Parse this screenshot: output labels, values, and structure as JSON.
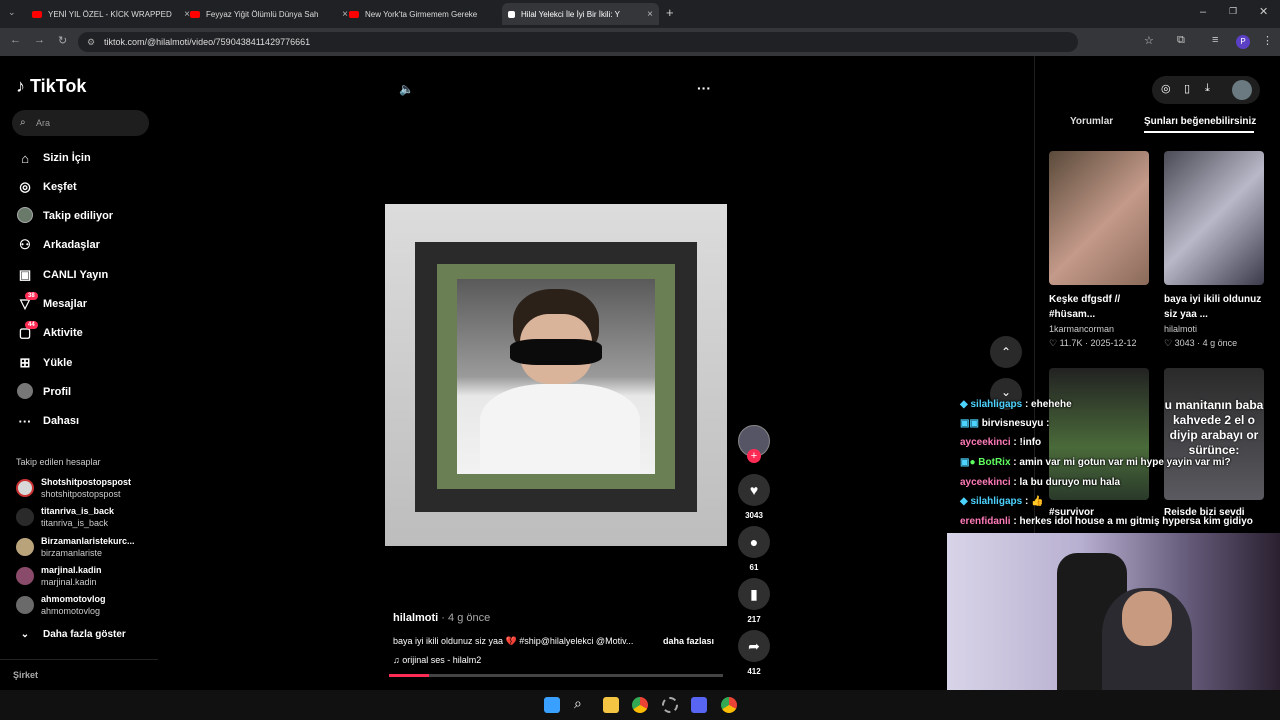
{
  "browser": {
    "tabs": [
      {
        "title": "YENİ YIL ÖZEL - KİCK WRAPPED"
      },
      {
        "title": "Feyyaz Yiğit Ölümlü Dünya Sah"
      },
      {
        "title": "New York'ta Girmemem Gereke"
      },
      {
        "title": "Hilal Yelekci İle İyi Bir İkili: Y"
      }
    ],
    "url": "tiktok.com/@hilalmoti/video/7590438411429776661"
  },
  "tiktok": {
    "logo": "TikTok",
    "search_placeholder": "Ara",
    "nav": [
      {
        "label": "Sizin İçin",
        "icon": "home-icon"
      },
      {
        "label": "Keşfet",
        "icon": "compass-icon"
      },
      {
        "label": "Takip ediliyor",
        "icon": "following-icon"
      },
      {
        "label": "Arkadaşlar",
        "icon": "friends-icon"
      },
      {
        "label": "CANLI Yayın",
        "icon": "live-icon"
      },
      {
        "label": "Mesajlar",
        "icon": "messages-icon",
        "badge": "38"
      },
      {
        "label": "Aktivite",
        "icon": "activity-icon",
        "badge": "44"
      },
      {
        "label": "Yükle",
        "icon": "upload-icon"
      },
      {
        "label": "Profil",
        "icon": "profile-icon"
      },
      {
        "label": "Dahası",
        "icon": "more-icon"
      }
    ],
    "following_heading": "Takip edilen hesaplar",
    "following": [
      {
        "name": "Shotshitpostopspost",
        "handle": "shotshitpostopspost"
      },
      {
        "name": "titanriva_is_back",
        "handle": "titanriva_is_back"
      },
      {
        "name": "Birzamanlaristekurc...",
        "handle": "birzamanlariste"
      },
      {
        "name": "marjinal.kadin",
        "handle": "marjinal.kadin"
      },
      {
        "name": "ahmomotovlog",
        "handle": "ahmomotovlog"
      }
    ],
    "show_more": "Daha fazla göster",
    "footer": "Şirket"
  },
  "video": {
    "author": "hilalmoti",
    "time": "· 4 g önce",
    "caption": "baya iyi ikili oldunuz siz yaa 💔 #ship@hilalyelekci @Motiv...",
    "more": "daha fazlası",
    "sound": "orijinal ses - hilalm2",
    "likes": "3043",
    "comments": "61",
    "saves": "217",
    "shares": "412",
    "progress": 0.12
  },
  "right": {
    "tabs": [
      "Yorumlar",
      "Şunları beğenebilirsiniz"
    ],
    "cards": [
      {
        "title": "Keşke dfgsdf // #hüsam...",
        "author": "1karmancorman",
        "likes": "11.7K",
        "date": "2025-12-12"
      },
      {
        "title": "baya iyi ikili oldunuz siz yaa ...",
        "author": "hilalmoti",
        "likes": "3043",
        "date": "4 g önce"
      },
      {
        "title": "#survivor"
      },
      {
        "title": "Reisde bizi sevdi"
      }
    ],
    "overlay_text": "u manitanın baba kahvede 2 el o diyip arabayı or sürünce:"
  },
  "chat": [
    {
      "user": "silahligaps",
      "msg": ": ehehehe",
      "color": "#4cd3ff"
    },
    {
      "user": "birvisnesuyu",
      "msg": ":",
      "color": "#ffffff"
    },
    {
      "user": "ayceekinci",
      "msg": ": !info",
      "color": "#ff7ab8"
    },
    {
      "user": "BotRix",
      "msg": ": amin var mi gotun var mi hype yayin var mi?",
      "color": "#5fff5f"
    },
    {
      "user": "ayceekinci",
      "msg": ": la bu duruyo mu hala",
      "color": "#ff7ab8"
    },
    {
      "user": "silahligaps",
      "msg": ": 👍",
      "color": "#4cd3ff"
    },
    {
      "user": "erenfidanli",
      "msg": ": herkes idol house a mı gitmiş hypersa kim gidiyo",
      "color": "#ff7ab8"
    }
  ],
  "colors": {
    "accent": "#fe2c55",
    "bg": "#000000"
  }
}
